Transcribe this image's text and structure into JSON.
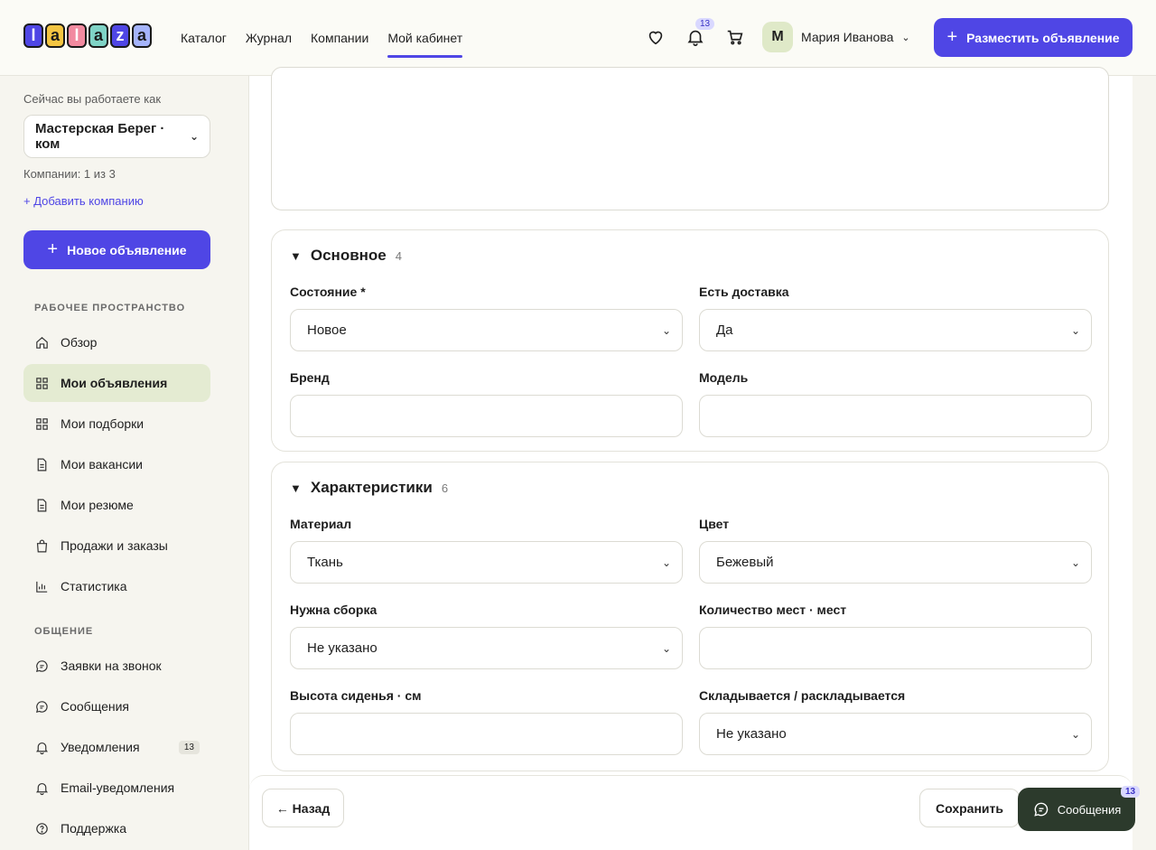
{
  "header": {
    "logo_letters": [
      "l",
      "a",
      "l",
      "a",
      "z",
      "a"
    ],
    "nav": [
      "Каталог",
      "Журнал",
      "Компании",
      "Мой кабинет"
    ],
    "notifications_count": "13",
    "user_initial": "М",
    "user_name": "Мария Иванова",
    "cta_label": "Разместить объявление"
  },
  "sidebar": {
    "hint": "Сейчас вы работаете как",
    "company_select": "Мастерская Берег · ком",
    "companies_count": "Компании: 1 из 3",
    "add_company": "+ Добавить компанию",
    "new_listing": "Новое объявление",
    "section_workspace": "РАБОЧЕЕ ПРОСТРАНСТВО",
    "workspace_items": [
      "Обзор",
      "Мои объявления",
      "Мои подборки",
      "Мои вакансии",
      "Мои резюме",
      "Продажи и заказы",
      "Статистика"
    ],
    "section_comm": "ОБЩЕНИЕ",
    "comm_items": [
      "Заявки на звонок",
      "Сообщения",
      "Уведомления",
      "Email-уведомления",
      "Поддержка"
    ],
    "notifications_badge": "13"
  },
  "main": {
    "basic": {
      "title": "Основное",
      "count": "4",
      "condition_label": "Состояние *",
      "condition_value": "Новое",
      "delivery_label": "Есть доставка",
      "delivery_value": "Да",
      "brand_label": "Бренд",
      "model_label": "Модель"
    },
    "specs": {
      "title": "Характеристики",
      "count": "6",
      "material_label": "Материал",
      "material_value": "Ткань",
      "color_label": "Цвет",
      "color_value": "Бежевый",
      "assembly_label": "Нужна сборка",
      "assembly_value": "Не указано",
      "seats_label": "Количество мест · мест",
      "seat_height_label": "Высота сиденья · см",
      "folding_label": "Складывается / раскладывается",
      "folding_value": "Не указано"
    }
  },
  "bottom": {
    "back_label": "← Назад",
    "save_label": "Сохранить",
    "messages_label": "Сообщения",
    "messages_badge": "13"
  },
  "colors": {
    "accent": "#4f46e5",
    "active_bg": "#e4ebd2",
    "dark_chip": "#2c3a2c"
  }
}
